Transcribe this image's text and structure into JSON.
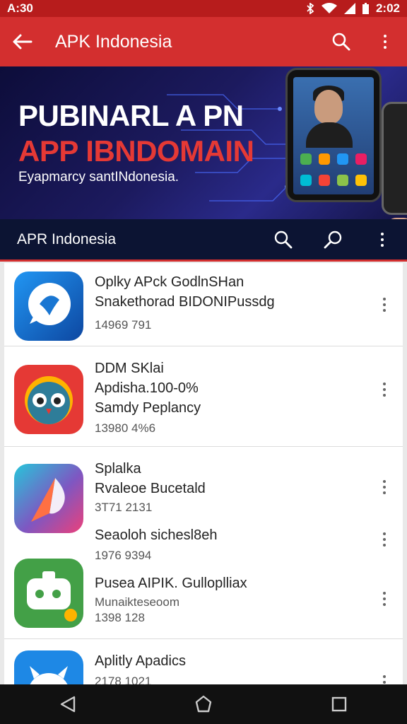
{
  "status": {
    "time_left": "A:30",
    "time_right": "2:02"
  },
  "appbar": {
    "title": "APK Indonesia"
  },
  "banner": {
    "headline_1": "PUBINARL A PN",
    "headline_2": "APP IBNDOMAIN",
    "tagline": "Eyapmarcy santINdonesia."
  },
  "subbar": {
    "title": "APR Indonesia"
  },
  "apps": [
    {
      "lines": [
        "Oplky APck GodlnSHan",
        "Snakethorad BIDONIPussdg"
      ],
      "meta": [
        "14969 791"
      ]
    },
    {
      "lines": [
        "DDM SKlai",
        "Apdisha.100-0%",
        "Samdy Peplancy"
      ],
      "meta": [
        "13980 4%6"
      ]
    },
    {
      "lines": [
        "Splalka",
        "Rvaleoe Bucetald"
      ],
      "meta": [
        "3T71 2131"
      ]
    },
    {
      "lines": [
        "Seaoloh sichesl8eh"
      ],
      "meta": [
        "1976 9394"
      ]
    },
    {
      "lines": [
        "Pusea AIPIK. Gulloplliax"
      ],
      "meta": [
        "Munaikteseoom",
        "1398 128"
      ]
    },
    {
      "lines": [
        "Aplitly Apadics"
      ],
      "meta": [
        "2178 1021"
      ]
    }
  ],
  "colors": {
    "primary": "#d32f2f",
    "status": "#b71c1c",
    "banner_bg": "#1c1a5e",
    "subbar": "#0c1433"
  }
}
